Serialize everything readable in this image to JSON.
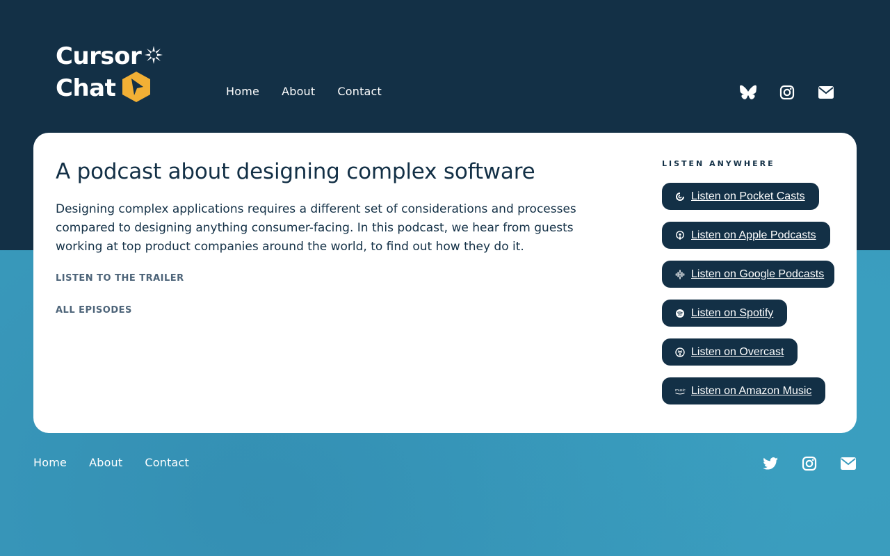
{
  "header": {
    "logo": {
      "line1": "Cursor",
      "line2": "Chat",
      "accent_color": "#f2b035"
    },
    "nav": [
      {
        "label": "Home"
      },
      {
        "label": "About"
      },
      {
        "label": "Contact"
      }
    ],
    "social": [
      "butterfly-icon",
      "instagram-icon",
      "envelope-icon"
    ]
  },
  "card": {
    "headline": "A podcast about designing complex software",
    "description": "Designing complex applications requires a different set of considerations and processes compared to designing anything consumer-facing. In this podcast, we hear from guests working at top product companies around the world, to find out how they do it.",
    "trailer_label": "LISTEN TO THE TRAILER",
    "episodes_label": "ALL EPISODES",
    "listen_title": "LISTEN ANYWHERE",
    "platforms": [
      {
        "label": "Listen on Pocket Casts",
        "icon": "pocket-casts-icon"
      },
      {
        "label": "Listen on Apple Podcasts",
        "icon": "apple-podcasts-icon"
      },
      {
        "label": "Listen on Google Podcasts",
        "icon": "google-podcasts-icon"
      },
      {
        "label": "Listen on Spotify",
        "icon": "spotify-icon"
      },
      {
        "label": "Listen on Overcast",
        "icon": "overcast-icon"
      },
      {
        "label": "Listen on Amazon Music",
        "icon": "amazon-music-icon"
      }
    ]
  },
  "footer": {
    "nav": [
      {
        "label": "Home"
      },
      {
        "label": "About"
      },
      {
        "label": "Contact"
      }
    ],
    "social": [
      "twitter-icon",
      "instagram-icon",
      "envelope-icon"
    ]
  },
  "colors": {
    "navy": "#133046",
    "teal_background": "#3a9bbd",
    "muted_text": "#4d6479",
    "white": "#ffffff"
  }
}
